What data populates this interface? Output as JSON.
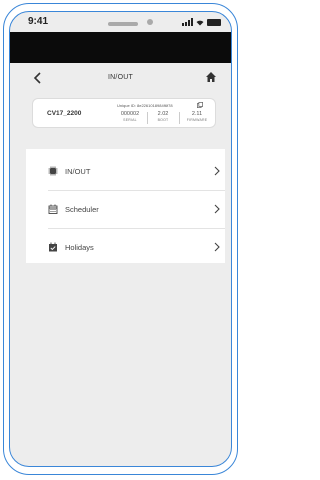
{
  "status_bar": {
    "time": "9:41"
  },
  "header": {
    "title": "IN/OUT"
  },
  "device": {
    "name": "CV17_2200",
    "unique_id": "Unique ID: 8e2261018984f6f78",
    "serial": {
      "value": "000002",
      "label": "SERIAL"
    },
    "boot": {
      "value": "2.02",
      "label": "BOOT"
    },
    "firmware": {
      "value": "2.11",
      "label": "FIRMWARE"
    }
  },
  "menu": {
    "items": [
      {
        "label": "IN/OUT",
        "icon": "chip-icon"
      },
      {
        "label": "Scheduler",
        "icon": "calendar-grid-icon"
      },
      {
        "label": "Holidays",
        "icon": "calendar-check-icon"
      }
    ]
  },
  "colors": {
    "frame": "#3a86d8",
    "background": "#ededed",
    "card": "#ffffff"
  }
}
